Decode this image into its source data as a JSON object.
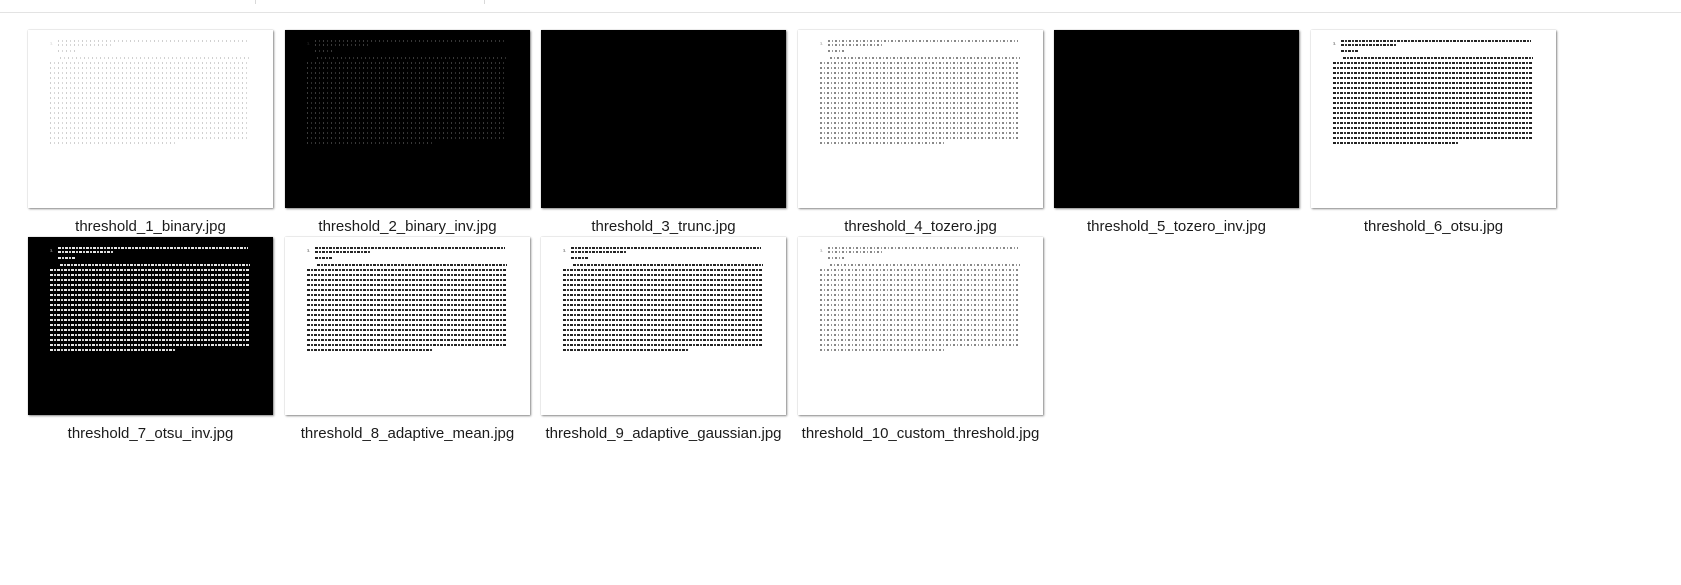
{
  "files": [
    {
      "name": "threshold_1_binary.jpg",
      "bg": "white",
      "ink": "faint"
    },
    {
      "name": "threshold_2_binary_inv.jpg",
      "bg": "black",
      "ink": "dim"
    },
    {
      "name": "threshold_3_trunc.jpg",
      "bg": "black",
      "ink": "none"
    },
    {
      "name": "threshold_4_tozero.jpg",
      "bg": "white",
      "ink": "gray"
    },
    {
      "name": "threshold_5_tozero_inv.jpg",
      "bg": "black",
      "ink": "none"
    },
    {
      "name": "threshold_6_otsu.jpg",
      "bg": "white",
      "ink": "black"
    },
    {
      "name": "threshold_7_otsu_inv.jpg",
      "bg": "black",
      "ink": "white"
    },
    {
      "name": "threshold_8_adaptive_mean.jpg",
      "bg": "white",
      "ink": "black"
    },
    {
      "name": "threshold_9_adaptive_gaussian.jpg",
      "bg": "white",
      "ink": "black"
    },
    {
      "name": "threshold_10_custom_threshold.jpg",
      "bg": "white",
      "ink": "gray"
    }
  ],
  "doc_section_number": "3."
}
